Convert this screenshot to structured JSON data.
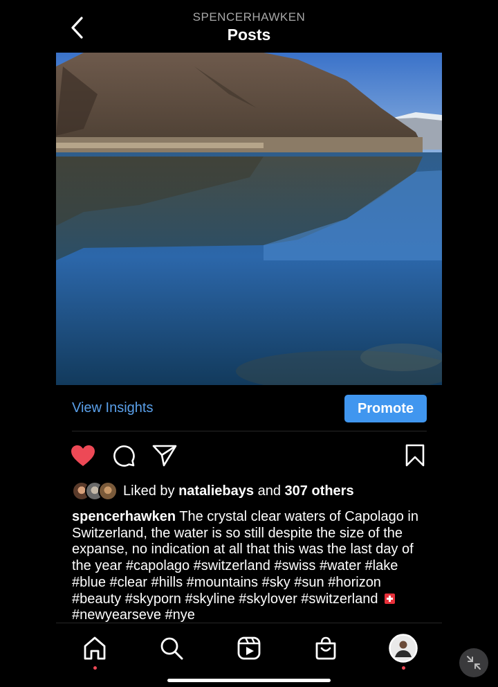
{
  "header": {
    "username": "SPENCERHAWKEN",
    "title": "Posts",
    "back_icon": "chevron-left-icon"
  },
  "post": {
    "image_description_icon": "landscape-photo",
    "view_insights_label": "View Insights",
    "promote_label": "Promote",
    "actions": {
      "like_icon": "heart-filled-icon",
      "comment_icon": "comment-icon",
      "share_icon": "send-icon",
      "save_icon": "bookmark-icon"
    },
    "likes": {
      "prefix": "Liked by",
      "user": "nataliebays",
      "middle": "and",
      "others": "307 others"
    },
    "caption": {
      "username": "spencerhawken",
      "text": "The crystal clear waters of Capolago in Switzerland, the water is so still despite the size of the expanse, no indication at all that this was the last day of the year #capolago #switzerland #swiss #water #lake #blue #clear #hills #mountains #sky #sun #horizon #beauty #skyporn #skyline #skylover #switzerland",
      "after_flag": "#newyearseve #nye"
    }
  },
  "tabbar": {
    "tabs": [
      "home-icon",
      "search-icon",
      "reels-icon",
      "shop-icon",
      "profile-avatar"
    ]
  },
  "colors": {
    "accent_blue": "#4096ef",
    "link_blue": "#5aa0ea",
    "like_red": "#ed4956",
    "background": "#000000"
  }
}
